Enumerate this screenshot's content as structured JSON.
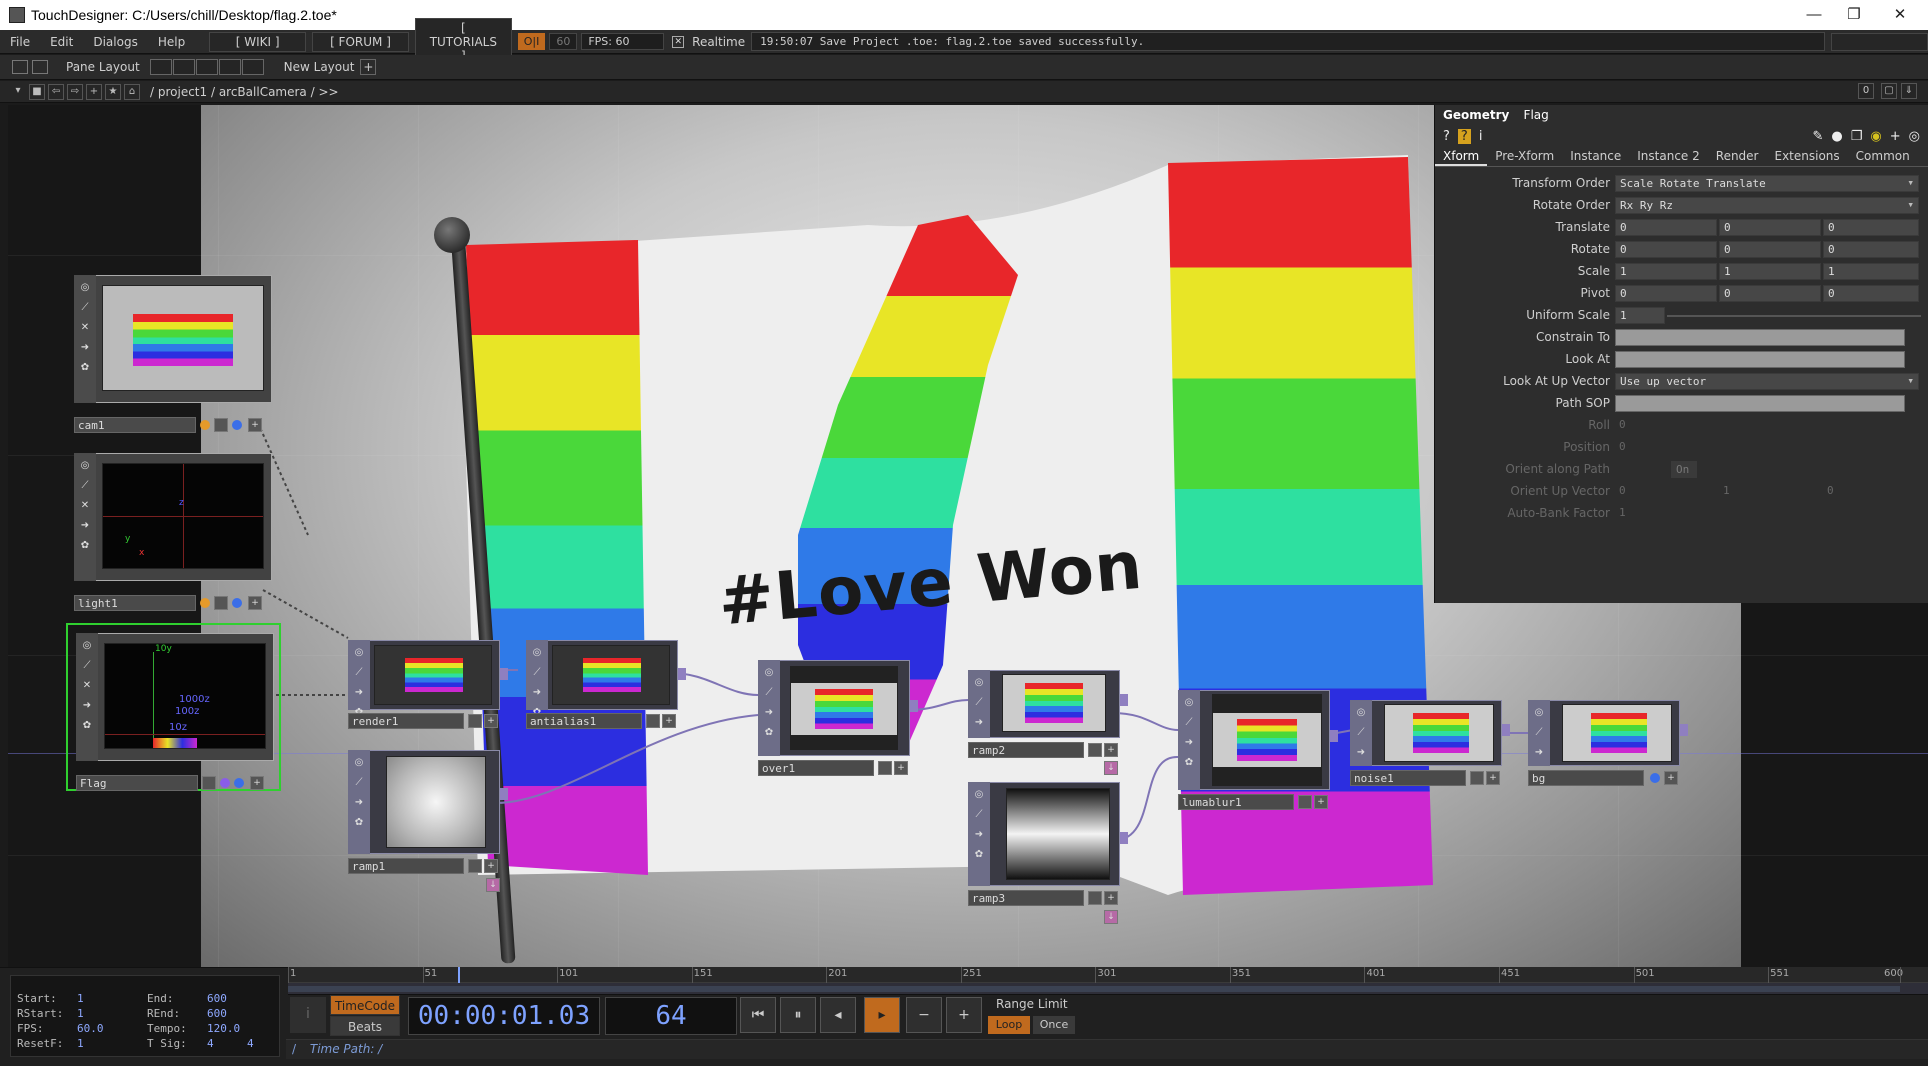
{
  "window": {
    "title": "TouchDesigner: C:/Users/chill/Desktop/flag.2.toe*",
    "minimize": "—",
    "maximize": "❐",
    "close": "✕"
  },
  "menu": {
    "items": [
      "File",
      "Edit",
      "Dialogs",
      "Help"
    ],
    "wiki": "[ WIKI ]",
    "forum": "[ FORUM ]",
    "tutorials": "[ TUTORIALS ]",
    "oi": "O|I",
    "fps_target": "60",
    "fps_readout": "FPS:  60",
    "realtime_check": "✕",
    "realtime_label": "Realtime",
    "status_message": "19:50:07 Save Project .toe: flag.2.toe saved successfully."
  },
  "panebar": {
    "pane_layout_label": "Pane Layout",
    "new_layout_label": "New Layout",
    "new_layout_plus": "+"
  },
  "pathbar": {
    "path": "/ project1 / arcBallCamera / >>",
    "right_value": "0"
  },
  "artwork": {
    "slogan": "#Love Won"
  },
  "nodes": {
    "cam1": "cam1",
    "light1": "light1",
    "flag": "Flag",
    "render1": "render1",
    "antialias1": "antialias1",
    "over1": "over1",
    "ramp2": "ramp2",
    "lumablur1": "lumablur1",
    "noise1": "noise1",
    "bg": "bg",
    "ramp1": "ramp1",
    "ramp3": "ramp3",
    "flag_axis_y": "10y",
    "flag_axis_z": "1000z",
    "flag_axis_z2": "100z",
    "flag_axis_z3": "10z",
    "light_axis_y": "y",
    "light_axis_z": "z",
    "light_axis_x": "x"
  },
  "params": {
    "type": "Geometry",
    "name": "Flag",
    "tabs": [
      "Xform",
      "Pre-Xform",
      "Instance",
      "Instance 2",
      "Render",
      "Extensions",
      "Common"
    ],
    "rows": {
      "transform_order": {
        "label": "Transform Order",
        "value": "Scale Rotate Translate"
      },
      "rotate_order": {
        "label": "Rotate Order",
        "value": "Rx Ry Rz"
      },
      "translate": {
        "label": "Translate",
        "x": "0",
        "y": "0",
        "z": "0"
      },
      "rotate": {
        "label": "Rotate",
        "x": "0",
        "y": "0",
        "z": "0"
      },
      "scale": {
        "label": "Scale",
        "x": "1",
        "y": "1",
        "z": "1"
      },
      "pivot": {
        "label": "Pivot",
        "x": "0",
        "y": "0",
        "z": "0"
      },
      "uniform_scale": {
        "label": "Uniform Scale",
        "value": "1"
      },
      "constrain_to": {
        "label": "Constrain To"
      },
      "look_at": {
        "label": "Look At"
      },
      "look_at_up_vector": {
        "label": "Look At Up Vector",
        "value": "Use up vector"
      },
      "path_sop": {
        "label": "Path SOP"
      },
      "roll": {
        "label": "Roll",
        "value": "0"
      },
      "position": {
        "label": "Position",
        "value": "0"
      },
      "orient_along_path": {
        "label": "Orient along Path",
        "value": "On"
      },
      "orient_up_vector": {
        "label": "Orient Up Vector",
        "x": "0",
        "y": "1",
        "z": "0"
      },
      "auto_bank_factor": {
        "label": "Auto-Bank Factor",
        "value": "1"
      }
    }
  },
  "timeline": {
    "start_label": "Start:",
    "start": "1",
    "end_label": "End:",
    "end": "600",
    "rstart_label": "RStart:",
    "rstart": "1",
    "rend_label": "REnd:",
    "rend": "600",
    "fps_label": "FPS:",
    "fps": "60.0",
    "tempo_label": "Tempo:",
    "tempo": "120.0",
    "resetf_label": "ResetF:",
    "resetf": "1",
    "tsig_label": "T Sig:",
    "tsig_a": "4",
    "tsig_b": "4",
    "ruler_ticks": [
      "1",
      "51",
      "101",
      "151",
      "201",
      "251",
      "301",
      "351",
      "401",
      "451",
      "501",
      "551",
      "600"
    ],
    "playhead_frame": 64,
    "timecode_btn": "TimeCode",
    "beats_btn": "Beats",
    "timecode": "00:00:01.03",
    "frame": "64",
    "range_limit": "Range Limit",
    "loop": "Loop",
    "once": "Once",
    "time_path": "Time Path: /",
    "slash": "/",
    "side_marker": "i"
  },
  "colors": {
    "accent_orange": "#c06a1e",
    "timecode_blue": "#7ea2ff",
    "selected_green": "#2fd02f",
    "node_purple": "#6d6d88"
  }
}
